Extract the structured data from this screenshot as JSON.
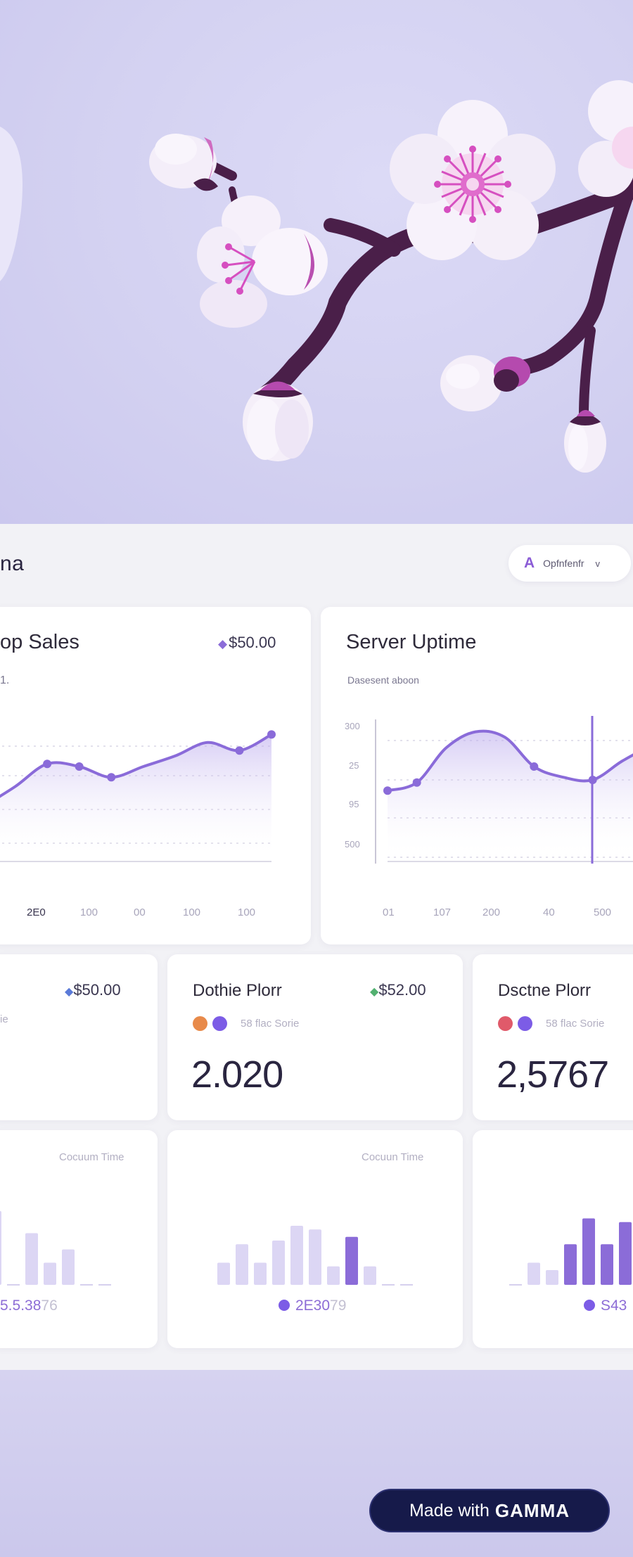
{
  "header": {
    "title": "na",
    "dropdown": {
      "icon": "A",
      "label": "Opfnfenfr",
      "chevron": "v"
    }
  },
  "top_sales": {
    "title": "op Sales",
    "subtitle": "1.",
    "value": "$50.00",
    "value_icon": "diamond-icon",
    "x_ticks": [
      "2E0",
      "100",
      "00",
      "100",
      "100"
    ],
    "chart_data": {
      "type": "line",
      "x": [
        0,
        1,
        2,
        3,
        4,
        5,
        6,
        7,
        8,
        9
      ],
      "y": [
        40,
        55,
        72,
        70,
        62,
        70,
        78,
        88,
        82,
        94
      ]
    }
  },
  "server_uptime": {
    "title": "Server Uptime",
    "subtitle": "Dasesent aboon",
    "y_ticks": [
      "300",
      "25",
      "95",
      "500"
    ],
    "x_ticks": [
      "01",
      "107",
      "200",
      "40",
      "500"
    ],
    "chart_data": {
      "type": "line",
      "x": [
        0,
        1,
        2,
        3,
        4,
        5,
        6,
        7,
        8,
        9
      ],
      "y": [
        52,
        58,
        84,
        96,
        92,
        70,
        62,
        60,
        74,
        86
      ]
    }
  },
  "metrics": [
    {
      "title": "",
      "value": "$50.00",
      "legend": "ie",
      "big": ""
    },
    {
      "title": "Dothie Plorr",
      "value": "$52.00",
      "legend": "58 flac Sorie",
      "big": "2.020"
    },
    {
      "title": "Dsctne Plorr",
      "value": "",
      "legend": "58 flac Sorie",
      "big": "2,5767"
    }
  ],
  "bar_cards": [
    {
      "label": "Cocuum Time",
      "foot_main": "5.5.38",
      "foot_muted": "76",
      "chart_data": {
        "type": "bar",
        "values": [
          100,
          0,
          70,
          30,
          48,
          0,
          0
        ]
      }
    },
    {
      "label": "Cocuun Time",
      "foot_main": "2E30",
      "foot_muted": "79",
      "chart_data": {
        "type": "bar",
        "values": [
          30,
          55,
          30,
          60,
          80,
          75,
          25,
          65,
          25,
          0,
          0
        ]
      }
    },
    {
      "label": "",
      "foot_main": "S43",
      "foot_muted": "",
      "chart_data": {
        "type": "bar",
        "values": [
          0,
          30,
          20,
          55,
          90,
          55,
          85
        ]
      }
    }
  ],
  "badge": {
    "made": "Made with",
    "brand": "GAMMA"
  },
  "colors": {
    "accent": "#8b6cd8",
    "line": "#8a6bd9",
    "bar_light": "#dcd6f4",
    "bar_dark": "#8b6cd8",
    "badge_bg": "#161a4a"
  }
}
